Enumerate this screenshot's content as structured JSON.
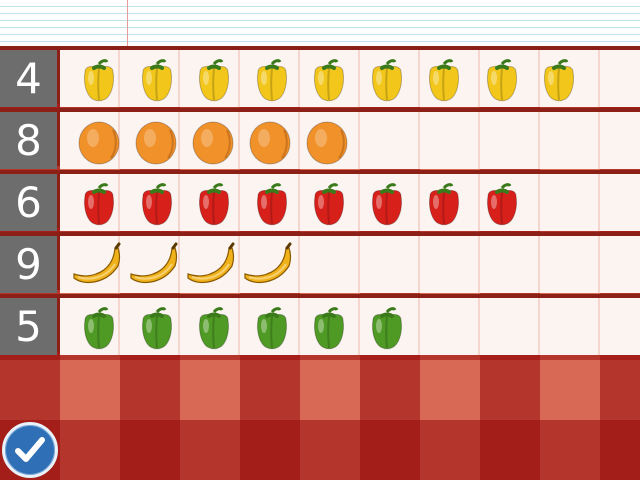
{
  "rows": [
    {
      "number": "4",
      "fruit": "yellow-pepper",
      "count": 9,
      "color": "#f2c61a"
    },
    {
      "number": "8",
      "fruit": "orange-fruit",
      "count": 5,
      "color": "#f0912a"
    },
    {
      "number": "6",
      "fruit": "red-pepper",
      "count": 8,
      "color": "#d8201b"
    },
    {
      "number": "9",
      "fruit": "banana",
      "count": 4,
      "color": "#f0b21a"
    },
    {
      "number": "5",
      "fruit": "green-pepper",
      "count": 6,
      "color": "#4f9a24"
    }
  ],
  "check_button": {
    "icon": "checkmark-icon"
  }
}
